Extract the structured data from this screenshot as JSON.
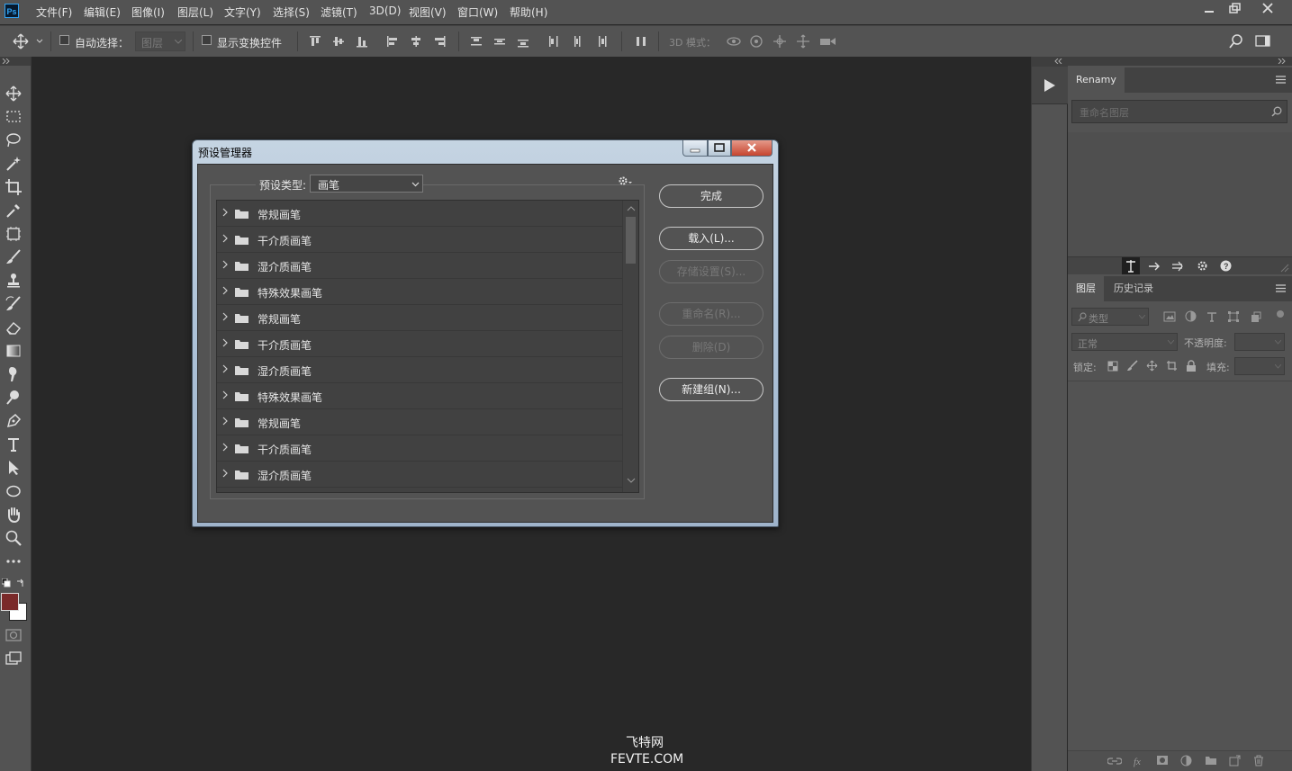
{
  "app": {
    "logo_text": "Ps",
    "menu": [
      "文件(F)",
      "编辑(E)",
      "图像(I)",
      "图层(L)",
      "文字(Y)",
      "选择(S)",
      "滤镜(T)",
      "3D(D)",
      "视图(V)",
      "窗口(W)",
      "帮助(H)"
    ]
  },
  "options_bar": {
    "auto_select_label": "自动选择：",
    "auto_select_target": "图层",
    "show_transform_label": "显示变换控件",
    "mode_3d_label": "3D 模式："
  },
  "dialog": {
    "title": "预设管理器",
    "preset_type_label": "预设类型:",
    "preset_type_value": "画笔",
    "items": [
      "常规画笔",
      "干介质画笔",
      "湿介质画笔",
      "特殊效果画笔",
      "常规画笔",
      "干介质画笔",
      "湿介质画笔",
      "特殊效果画笔",
      "常规画笔",
      "干介质画笔",
      "湿介质画笔"
    ],
    "buttons": {
      "done": "完成",
      "load": "载入(L)...",
      "save": "存储设置(S)...",
      "rename": "重命名(R)...",
      "delete": "删除(D)",
      "new_group": "新建组(N)..."
    }
  },
  "renamy_panel": {
    "tab": "Renamy",
    "search_placeholder": "重命名图层"
  },
  "layers_panel": {
    "tabs": [
      "图层",
      "历史记录"
    ],
    "filter_kind": "类型",
    "blend_mode": "正常",
    "opacity_label": "不透明度:",
    "lock_label": "锁定:",
    "fill_label": "填充:"
  },
  "watermark": {
    "line1": "飞特网",
    "line2": "FEVTE.COM"
  },
  "colors": {
    "foreground": "#7a2a2a",
    "background": "#ffffff"
  }
}
